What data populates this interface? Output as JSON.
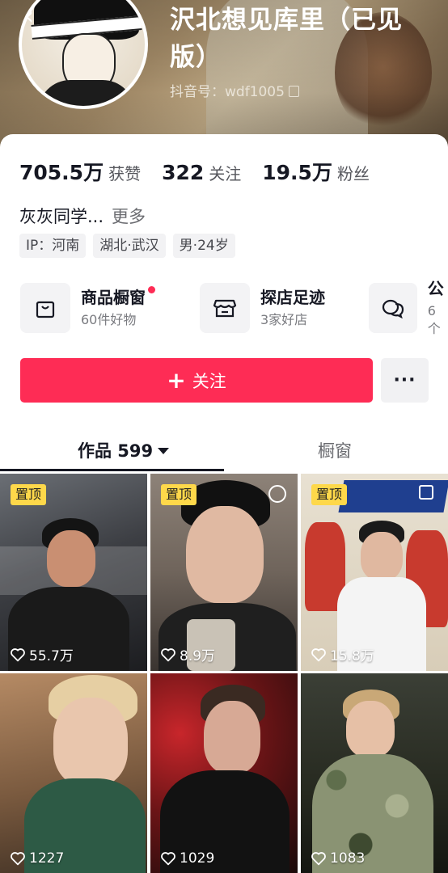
{
  "profile": {
    "name": "沢北想见库里（已见版）",
    "douyin_id": "抖音号：wdf1005",
    "stats": [
      {
        "value": "705.5万",
        "label": "获赞"
      },
      {
        "value": "322",
        "label": "关注"
      },
      {
        "value": "19.5万",
        "label": "粉丝"
      }
    ],
    "bio": "灰灰同学...",
    "bio_more": "更多",
    "tags": [
      "IP：河南",
      "湖北·武汉",
      "男·24岁"
    ]
  },
  "features": [
    {
      "title": "商品橱窗",
      "sub": "60件好物",
      "icon": "shopping-bag-icon"
    },
    {
      "title": "探店足迹",
      "sub": "3家好店",
      "icon": "store-icon"
    },
    {
      "title": "公",
      "sub": "6个",
      "icon": "chat-bubbles-icon"
    }
  ],
  "actions": {
    "follow": "关注",
    "more": "···"
  },
  "tabs": {
    "works": "作品 599",
    "window": "橱窗"
  },
  "videos": [
    {
      "pinned": "置顶",
      "likes": "55.7万"
    },
    {
      "pinned": "置顶",
      "likes": "8.9万"
    },
    {
      "pinned": "置顶",
      "likes": "15.8万"
    },
    {
      "pinned": "",
      "likes": "1227"
    },
    {
      "pinned": "",
      "likes": "1029"
    },
    {
      "pinned": "",
      "likes": "1083"
    }
  ],
  "colors": {
    "accent": "#fe2c55",
    "pin": "#fed84a",
    "text": "#161823"
  }
}
